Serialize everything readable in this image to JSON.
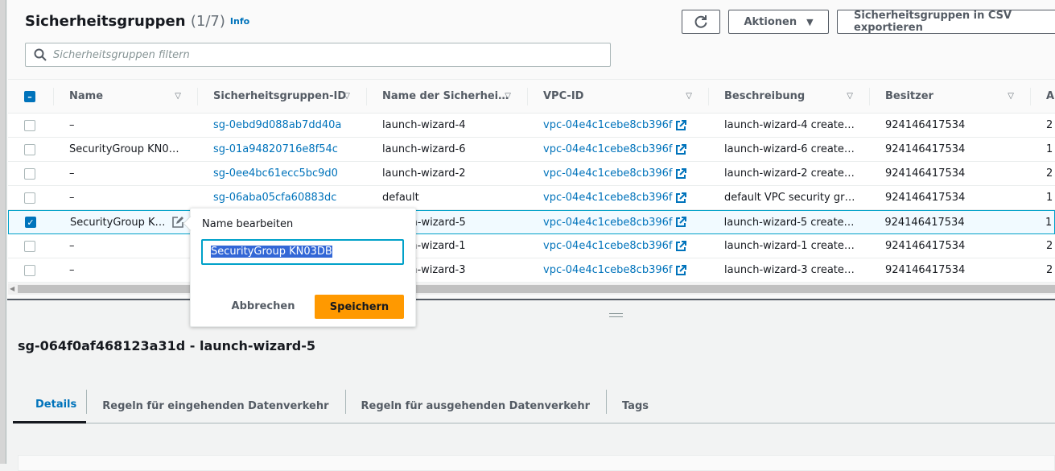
{
  "header": {
    "title": "Sicherheitsgruppen",
    "count": "(1/7)",
    "info": "Info"
  },
  "search": {
    "placeholder": "Sicherheitsgruppen filtern"
  },
  "toolbar": {
    "refresh": "refresh-icon",
    "actions": "Aktionen",
    "export": "Sicherheitsgruppen in CSV exportieren"
  },
  "table": {
    "columns": [
      "Name",
      "Sicherheitsgruppen-ID",
      "Name der Sicherhei…",
      "VPC-ID",
      "Beschreibung",
      "Besitzer",
      "A"
    ],
    "rows": [
      {
        "name": "–",
        "id": "sg-0ebd9d088ab7dd40a",
        "group": "launch-wizard-4",
        "vpc": "vpc-04e4c1cebe8cb396f",
        "desc": "launch-wizard-4 create…",
        "owner": "924146417534",
        "extra": "2",
        "selected": false
      },
      {
        "name": "SecurityGroup KN0…",
        "id": "sg-01a94820716e8f54c",
        "group": "launch-wizard-6",
        "vpc": "vpc-04e4c1cebe8cb396f",
        "desc": "launch-wizard-6 create…",
        "owner": "924146417534",
        "extra": "1",
        "selected": false
      },
      {
        "name": "–",
        "id": "sg-0ee4bc61ecc5bc9d0",
        "group": "launch-wizard-2",
        "vpc": "vpc-04e4c1cebe8cb396f",
        "desc": "launch-wizard-2 create…",
        "owner": "924146417534",
        "extra": "2",
        "selected": false
      },
      {
        "name": "–",
        "id": "sg-06aba05cfa60883dc",
        "group": "default",
        "vpc": "vpc-04e4c1cebe8cb396f",
        "desc": "default VPC security gr…",
        "owner": "924146417534",
        "extra": "1",
        "selected": false
      },
      {
        "name": "SecurityGroup K…",
        "id": "",
        "group": "launch-wizard-5",
        "vpc": "vpc-04e4c1cebe8cb396f",
        "desc": "launch-wizard-5 create…",
        "owner": "924146417534",
        "extra": "1",
        "selected": true
      },
      {
        "name": "–",
        "id": "",
        "group": "launch-wizard-1",
        "vpc": "vpc-04e4c1cebe8cb396f",
        "desc": "launch-wizard-1 create…",
        "owner": "924146417534",
        "extra": "2",
        "selected": false
      },
      {
        "name": "–",
        "id": "",
        "group": "launch-wizard-3",
        "vpc": "vpc-04e4c1cebe8cb396f",
        "desc": "launch-wizard-3 create…",
        "owner": "924146417534",
        "extra": "2",
        "selected": false
      }
    ]
  },
  "popover": {
    "label": "Name bearbeiten",
    "value": "SecurityGroup KN03DB",
    "cancel": "Abbrechen",
    "save": "Speichern"
  },
  "details": {
    "title": "sg-064f0af468123a31d - launch-wizard-5",
    "tabs": [
      "Details",
      "Regeln für eingehenden Datenverkehr",
      "Regeln für ausgehenden Datenverkehr",
      "Tags"
    ],
    "active_tab": "Details"
  }
}
